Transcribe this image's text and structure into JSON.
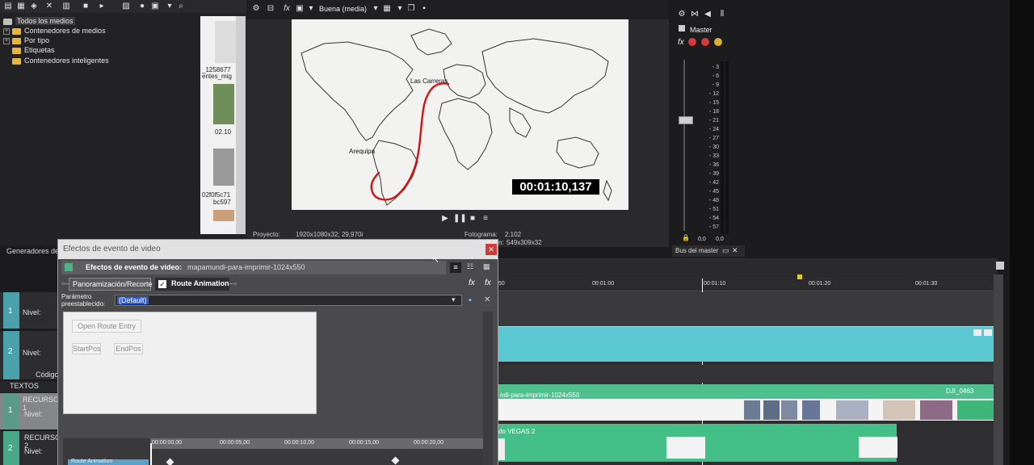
{
  "explorer": {
    "tree": [
      {
        "label": "Todos los medios",
        "expandable": false,
        "selected": true
      },
      {
        "label": "Contenedores de medios",
        "expandable": true
      },
      {
        "label": "Por tipo",
        "expandable": true
      },
      {
        "label": "Etiquetas",
        "expandable": false
      },
      {
        "label": "Contenedores inteligentes",
        "expandable": false
      }
    ],
    "media_items": [
      {
        "name_line1": "_1258677",
        "name_line2": "entes_mig"
      },
      {
        "name_line1": "02.10",
        "name_line2": ""
      },
      {
        "name_line1": "02f0f5c71",
        "name_line2": "bc597"
      }
    ],
    "tab_label": "Generadores de"
  },
  "preview": {
    "quality": "Buena (media)",
    "map_labels": {
      "la_carreras": "Las Carreras",
      "arequipa": "Arequipa"
    },
    "timecode": "00:01:10,137",
    "info": {
      "project_label": "Proyecto:",
      "project_value": "1920x1080x32; 29,970i",
      "frame_label": "Fotograma:",
      "frame_value": "2.102",
      "display_value": "549x309x32",
      "display_prefix": "n:"
    }
  },
  "master": {
    "title": "Master",
    "fx_label": "fx",
    "meter_labels": [
      "3",
      "6",
      "9",
      "12",
      "15",
      "18",
      "21",
      "24",
      "27",
      "30",
      "33",
      "36",
      "39",
      "42",
      "45",
      "48",
      "51",
      "54",
      "57"
    ],
    "meter_bottom": [
      "0,0",
      "0,0"
    ],
    "bus_tab": "Bus del master"
  },
  "timeline": {
    "ruler_labels": [
      "50",
      "00:01:00",
      "00:01:10",
      "00:01:20",
      "00:01:30"
    ],
    "tracks": [
      {
        "number": "1",
        "level_label": "Nivel:"
      },
      {
        "number": "2",
        "level_label": "Nivel:",
        "extra_label": "Código c"
      },
      {
        "number": "",
        "level_label": "TEXTOS"
      },
      {
        "number": "1",
        "name": "RECURSO 1",
        "level_label": "Nivel:"
      },
      {
        "number": "2",
        "name": "RECURSO 2",
        "level_label": "Nivel:"
      }
    ],
    "clips": {
      "track3_label": "ndi-para-imprimir-1024x550",
      "track3_right_label": "DJI_0463",
      "track4_label": "do VEGAS 2"
    }
  },
  "dialog": {
    "title": "Efectos de evento de video",
    "header_label": "Efectos de evento de video:",
    "header_file": "mapamundi-para-imprimir-1024x550",
    "chain": [
      "Panoramización/Recorte",
      "Route Animation"
    ],
    "preset_label_1": "Parámetro",
    "preset_label_2": "preestablecido:",
    "preset_value": "(Default)",
    "buttons": {
      "open_route": "Open Route Entry",
      "start": "StartPos",
      "end": "EndPos"
    },
    "kf_labels": [
      "00:00:00,00",
      "00:00:05,00",
      "00:00:10,00",
      "00:00:15,00",
      "00:00:20,00"
    ],
    "kf_track_label": "Route Animation"
  }
}
